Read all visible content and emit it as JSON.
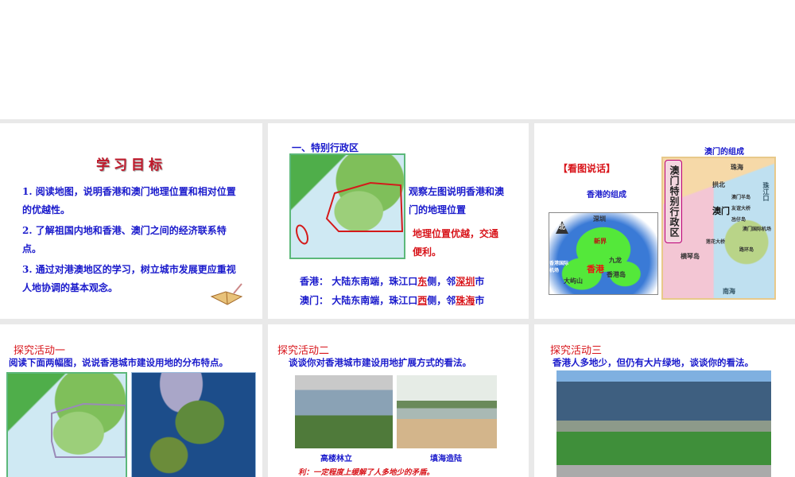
{
  "slide1": {
    "title": "学习目标",
    "goals": [
      "1. 阅读地图，说明香港和澳门地理位置和相对位置的优越性。",
      "2. 了解祖国内地和香港、澳门之间的经济联系特点。",
      "3. 通过对港澳地区的学习，树立城市发展更应重视人地协调的基本观念。"
    ]
  },
  "slide2": {
    "heading": "一、特别行政区",
    "observe": "观察左图说明香港和澳门的地理位置",
    "conclusion": "地理位置优越，交通便利。",
    "hk_label": "香港：",
    "hk_text1": "大陆东南端，珠江口",
    "hk_dir": "东",
    "hk_text2": "侧，邻",
    "hk_city": "深圳",
    "hk_text3": "市",
    "mo_label": "澳门：",
    "mo_text1": "大陆东南端，珠江口",
    "mo_dir": "西",
    "mo_text2": "侧，邻",
    "mo_city": "珠海",
    "mo_text3": "市"
  },
  "slide3": {
    "heading": "【看图说话】",
    "hk_caption": "香港的组成",
    "mo_caption": "澳门的组成",
    "hk_map": {
      "north": "北",
      "labels": [
        "深圳",
        "新界",
        "九龙",
        "香港",
        "香港岛",
        "大屿山",
        "香港国际机场"
      ]
    },
    "mo_map": {
      "side_title": "澳门特别行政区",
      "labels": [
        "珠海",
        "拱北",
        "澳门",
        "澳门半岛",
        "友谊大桥",
        "氹仔岛",
        "澳门国际机场",
        "路环岛",
        "横琴岛",
        "莲花大桥",
        "南海",
        "珠江口"
      ]
    }
  },
  "slide4": {
    "heading": "探究活动一",
    "question": "阅读下面两幅图，说说香港城市建设用地的分布特点。"
  },
  "slide5": {
    "heading": "探究活动二",
    "question": "谈谈你对香港城市建设用地扩展方式的看法。",
    "photo1_caption": "高楼林立",
    "photo2_caption": "填海造陆",
    "note": "利：一定程度上缓解了人多地少的矛盾。"
  },
  "slide6": {
    "heading": "探究活动三",
    "question": "香港人多地少，但仍有大片绿地，谈谈你的看法。"
  }
}
